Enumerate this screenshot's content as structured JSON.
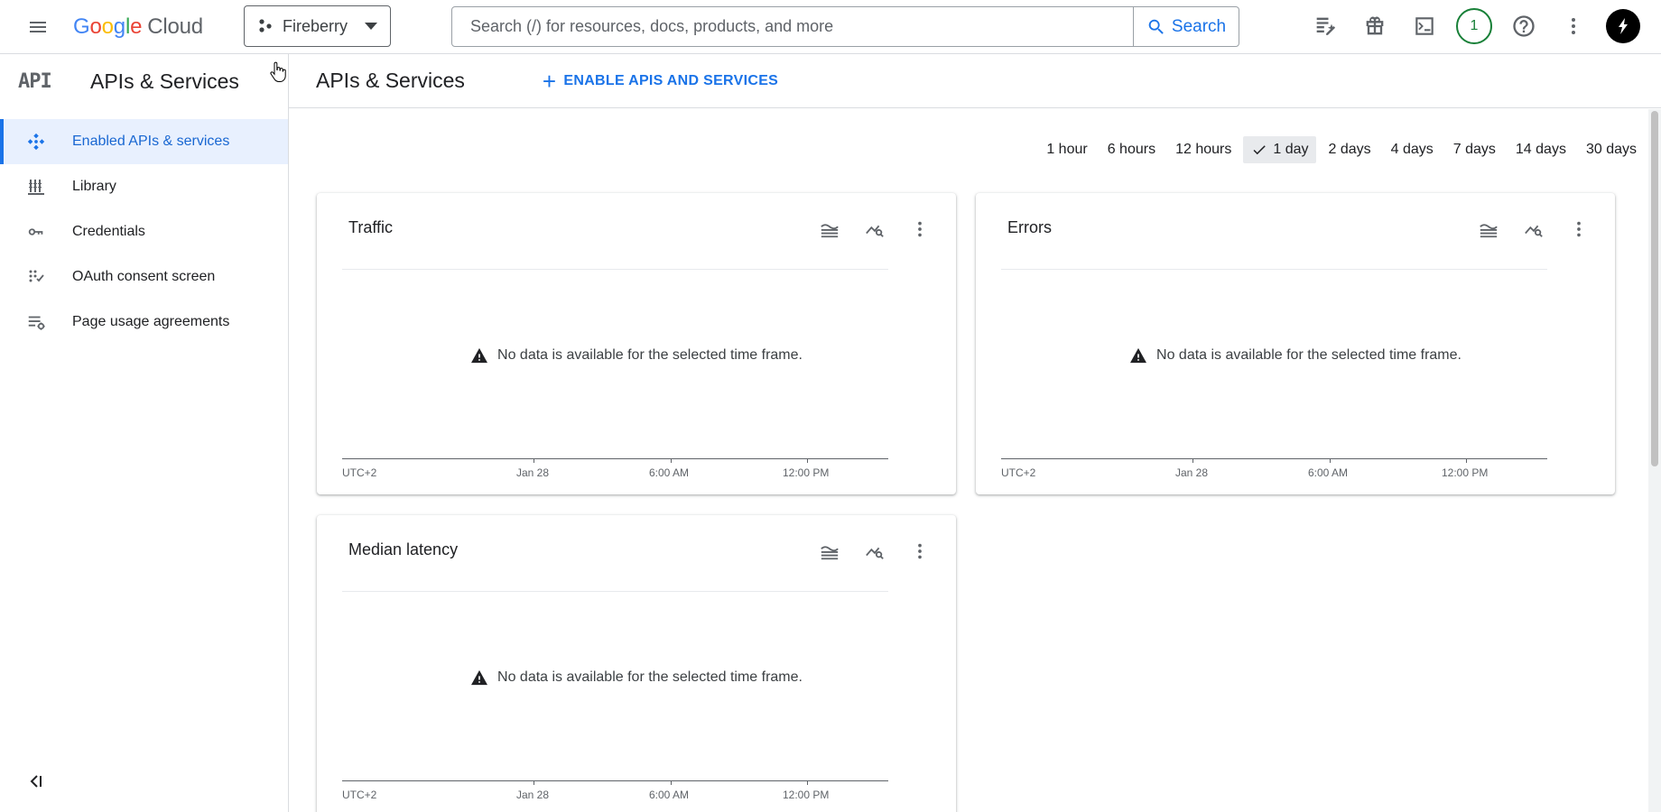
{
  "topbar": {
    "logo": {
      "g1": "G",
      "g2": "o",
      "g3": "o",
      "g4": "g",
      "g5": "l",
      "g6": "e",
      "cloud": "Cloud"
    },
    "project": "Fireberry",
    "search_placeholder": "Search (/) for resources, docs, products, and more",
    "search_label": "Search",
    "notification_count": "1"
  },
  "sidebar": {
    "logo_text": "API",
    "title": "APIs & Services",
    "items": [
      {
        "label": "Enabled APIs & services",
        "icon": "enabled-apis-icon",
        "active": true
      },
      {
        "label": "Library",
        "icon": "library-icon"
      },
      {
        "label": "Credentials",
        "icon": "key-icon"
      },
      {
        "label": "OAuth consent screen",
        "icon": "oauth-icon"
      },
      {
        "label": "Page usage agreements",
        "icon": "settings-list-icon"
      }
    ]
  },
  "header": {
    "title": "APIs & Services",
    "enable_label": "ENABLE APIS AND SERVICES"
  },
  "timeframes": {
    "options": [
      "1 hour",
      "6 hours",
      "12 hours",
      "1 day",
      "2 days",
      "4 days",
      "7 days",
      "14 days",
      "30 days"
    ],
    "selected": "1 day"
  },
  "cards": [
    {
      "title": "Traffic",
      "message": "No data is available for the selected time frame.",
      "ticks": [
        "UTC+2",
        "Jan 28",
        "6:00 AM",
        "12:00 PM"
      ]
    },
    {
      "title": "Errors",
      "message": "No data is available for the selected time frame.",
      "ticks": [
        "UTC+2",
        "Jan 28",
        "6:00 AM",
        "12:00 PM"
      ]
    },
    {
      "title": "Median latency",
      "message": "No data is available for the selected time frame.",
      "ticks": [
        "UTC+2",
        "Jan 28",
        "6:00 AM",
        "12:00 PM"
      ]
    }
  ],
  "colors": {
    "accent": "#1a73e8",
    "active_bg": "#e8f0fe",
    "badge": "#188038"
  }
}
